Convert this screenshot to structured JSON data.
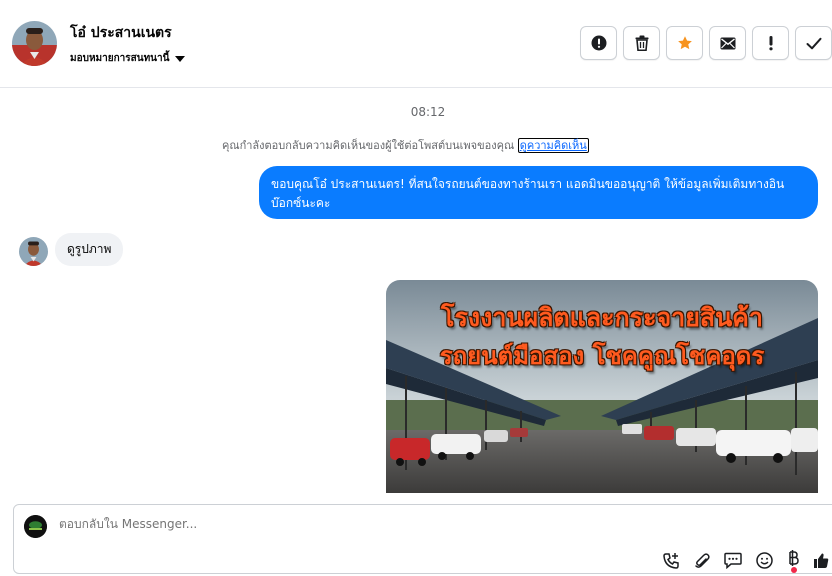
{
  "header": {
    "contact_name": "โอ๋ ประสานเนตร",
    "assign_label": "มอบหมายการสนทนานี้",
    "actions": [
      "spam-icon",
      "trash-icon",
      "star-icon",
      "envelope-icon",
      "important-icon",
      "check-icon"
    ]
  },
  "conversation": {
    "timestamp": "08:12",
    "notice_text": "คุณกำลังตอบกลับความคิดเห็นของผู้ใช้ต่อโพสต์บนเพจของคุณ",
    "notice_link": "ดูความคิดเห็น",
    "outgoing_message": "ขอบคุณโอ๋ ประสานเนตร! ที่สนใจรถยนต์ของทางร้านเรา แอดมินขออนุญาติ ให้ข้อมูลเพิ่มเติมทางอินบ๊อกซ์นะคะ",
    "incoming_message": "ดูรูปภาพ",
    "image_title_line1": "โรงงานผลิตและกระจายสินค้า",
    "image_title_line2": "รถยนต์มือสอง โชคคูณโชคอุดร"
  },
  "reply": {
    "placeholder": "ตอบกลับใน Messenger..."
  },
  "colors": {
    "bubble_out": "#0a7cff",
    "bubble_in": "#f0f2f5",
    "star": "#f7931e",
    "link": "#0866ff"
  }
}
